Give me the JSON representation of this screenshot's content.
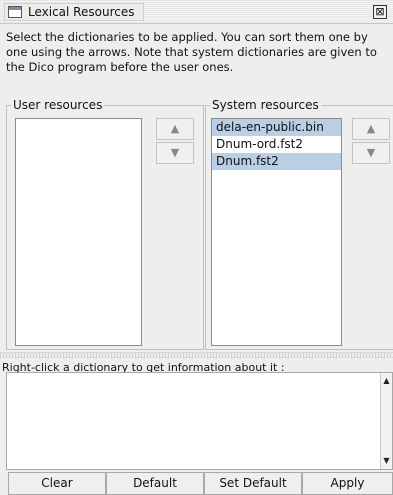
{
  "window": {
    "title": "Lexical Resources",
    "close_glyph": "⊠"
  },
  "description": "Select the dictionaries to be applied. You can sort them one by one using the arrows. Note that system dictionaries are given to the Dico program before the user ones.",
  "user_resources": {
    "title": "User resources",
    "items": []
  },
  "system_resources": {
    "title": "System resources",
    "items": [
      {
        "label": "dela-en-public.bin",
        "selected": true
      },
      {
        "label": "Dnum-ord.fst2",
        "selected": false
      },
      {
        "label": "Dnum.fst2",
        "selected": true
      }
    ]
  },
  "arrows": {
    "up": "▲",
    "down": "▼"
  },
  "info": {
    "label": "Right-click a dictionary to get information about it :",
    "value": ""
  },
  "buttons": {
    "clear": "Clear",
    "default": "Default",
    "set_default": "Set Default",
    "apply": "Apply"
  },
  "colors": {
    "selection": "#b8cfe5",
    "background": "#eeeeee"
  }
}
